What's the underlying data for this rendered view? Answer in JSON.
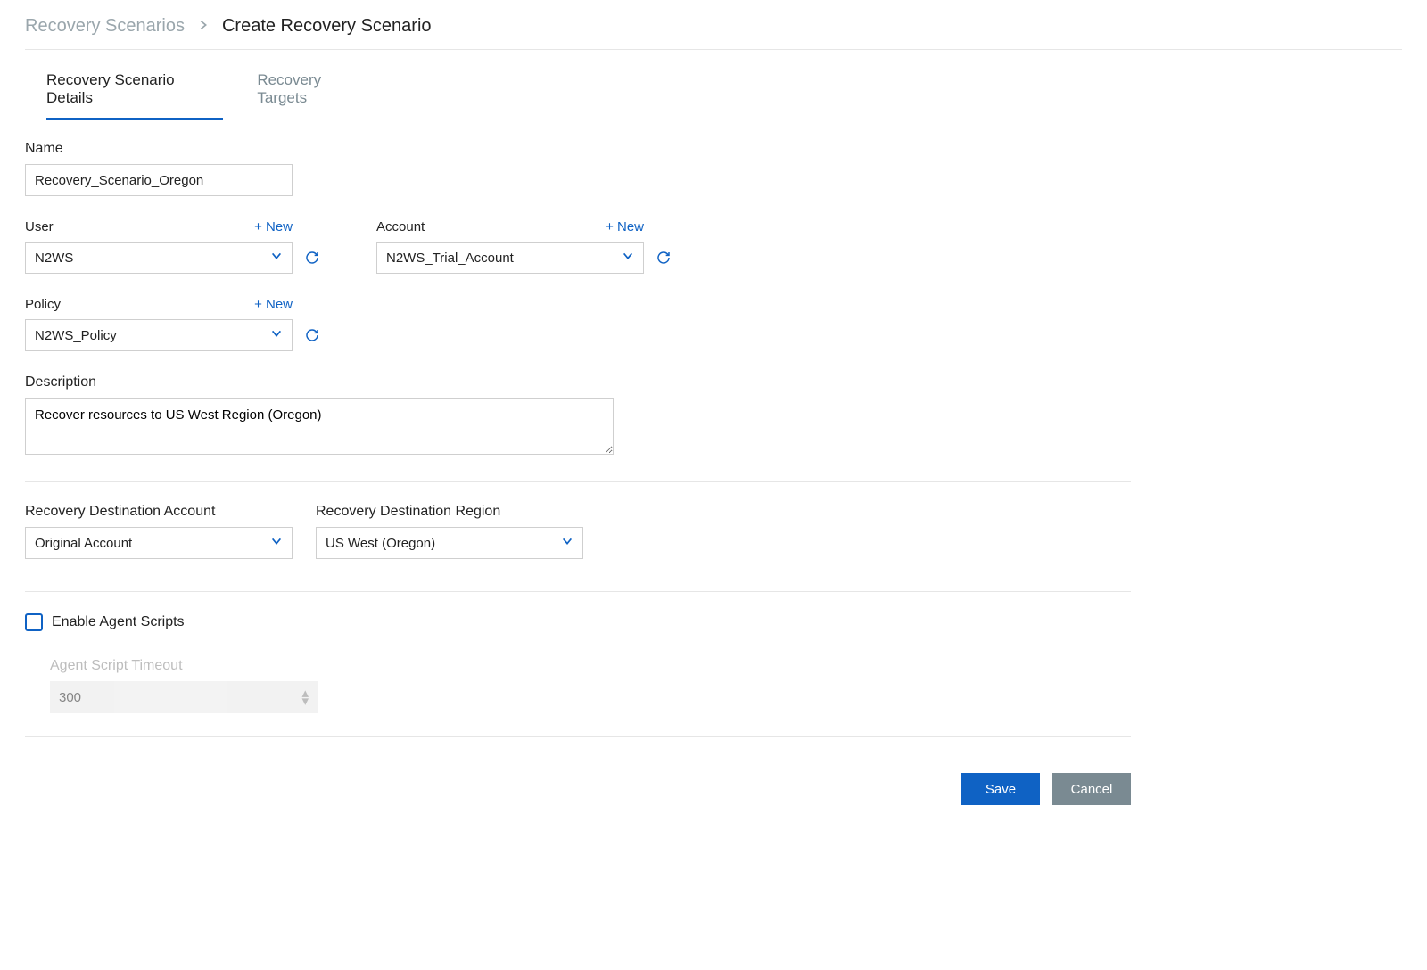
{
  "breadcrumb": {
    "back": "Recovery Scenarios",
    "current": "Create Recovery Scenario"
  },
  "tabs": [
    {
      "label": "Recovery Scenario Details",
      "active": true
    },
    {
      "label": "Recovery Targets",
      "active": false
    }
  ],
  "labels": {
    "name": "Name",
    "user": "User",
    "account": "Account",
    "policy": "Policy",
    "description": "Description",
    "recovery_dest_account": "Recovery Destination Account",
    "recovery_dest_region": "Recovery Destination Region",
    "enable_agent": "Enable Agent Scripts",
    "agent_timeout": "Agent Script Timeout",
    "new": "+ New"
  },
  "values": {
    "name": "Recovery_Scenario_Oregon",
    "user": "N2WS",
    "account": "N2WS_Trial_Account",
    "policy": "N2WS_Policy",
    "description": "Recover resources to US West Region (Oregon)",
    "recovery_dest_account": "Original Account",
    "recovery_dest_region": "US West (Oregon)",
    "agent_timeout": "300"
  },
  "buttons": {
    "save": "Save",
    "cancel": "Cancel"
  }
}
